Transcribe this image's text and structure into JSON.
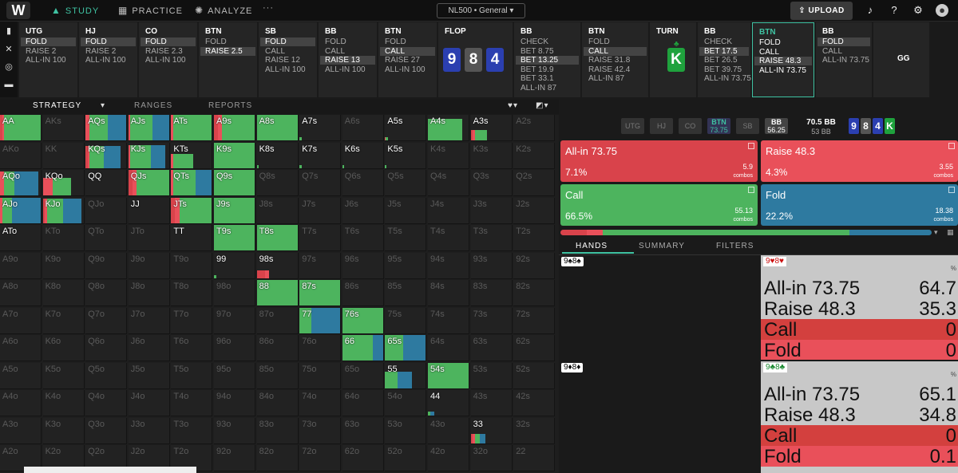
{
  "topbar": {
    "logo": "W",
    "nav": [
      {
        "label": "STUDY",
        "icon": "graduation-cap-icon"
      },
      {
        "label": "PRACTICE",
        "icon": "gamepad-icon"
      },
      {
        "label": "ANALYZE",
        "icon": "lightbulb-icon"
      }
    ],
    "more": "···",
    "game_select": "NL500 • General",
    "upload_label": "UPLOAD"
  },
  "action_columns": [
    {
      "title": "UTG",
      "options": [
        {
          "t": "FOLD",
          "sel": true
        },
        {
          "t": "RAISE 2"
        },
        {
          "t": "ALL-IN 100"
        }
      ]
    },
    {
      "title": "HJ",
      "options": [
        {
          "t": "FOLD",
          "sel": true
        },
        {
          "t": "RAISE 2"
        },
        {
          "t": "ALL-IN 100"
        }
      ]
    },
    {
      "title": "CO",
      "options": [
        {
          "t": "FOLD",
          "sel": true
        },
        {
          "t": "RAISE 2.3"
        },
        {
          "t": "ALL-IN 100"
        }
      ]
    },
    {
      "title": "BTN",
      "options": [
        {
          "t": "FOLD"
        },
        {
          "t": "RAISE 2.5",
          "sel": true
        }
      ]
    },
    {
      "title": "SB",
      "options": [
        {
          "t": "FOLD",
          "sel": true
        },
        {
          "t": "CALL"
        },
        {
          "t": "RAISE 12"
        },
        {
          "t": "ALL-IN 100"
        }
      ]
    },
    {
      "title": "BB",
      "options": [
        {
          "t": "FOLD"
        },
        {
          "t": "CALL"
        },
        {
          "t": "RAISE 13",
          "sel": true
        },
        {
          "t": "ALL-IN 100"
        }
      ]
    },
    {
      "title": "BTN",
      "options": [
        {
          "t": "FOLD"
        },
        {
          "t": "CALL",
          "sel": true
        },
        {
          "t": "RAISE 27"
        },
        {
          "t": "ALL-IN 100"
        }
      ]
    },
    {
      "title": "FLOP",
      "cards": [
        "9",
        "8",
        "4"
      ]
    },
    {
      "title": "BB",
      "options": [
        {
          "t": "CHECK"
        },
        {
          "t": "BET 8.75"
        },
        {
          "t": "BET 13.25",
          "sel": true
        },
        {
          "t": "BET 19.9"
        },
        {
          "t": "BET 33.1"
        },
        {
          "t": "ALL-IN 87"
        }
      ]
    },
    {
      "title": "BTN",
      "options": [
        {
          "t": "FOLD"
        },
        {
          "t": "CALL",
          "sel": true
        },
        {
          "t": "RAISE 31.8"
        },
        {
          "t": "RAISE 42.4"
        },
        {
          "t": "ALL-IN 87"
        }
      ]
    },
    {
      "title": "TURN",
      "cards": [
        "K"
      ]
    },
    {
      "title": "BB",
      "options": [
        {
          "t": "CHECK"
        },
        {
          "t": "BET 17.5",
          "sel": true
        },
        {
          "t": "BET 26.5"
        },
        {
          "t": "BET 39.75"
        },
        {
          "t": "ALL-IN 73.75"
        }
      ]
    },
    {
      "title": "BTN",
      "active": true,
      "options": [
        {
          "t": "FOLD"
        },
        {
          "t": "CALL"
        },
        {
          "t": "RAISE 48.3",
          "sel": true
        },
        {
          "t": "ALL-IN 73.75"
        }
      ]
    },
    {
      "title": "BB",
      "options": [
        {
          "t": "FOLD",
          "sel": true
        },
        {
          "t": "CALL"
        },
        {
          "t": "ALL-IN 73.75"
        }
      ]
    },
    {
      "title": "GG"
    }
  ],
  "main_tabs": [
    "STRATEGY",
    "RANGES",
    "REPORTS"
  ],
  "grid": {
    "ranks": [
      "A",
      "K",
      "Q",
      "J",
      "T",
      "9",
      "8",
      "7",
      "6",
      "5",
      "4",
      "3",
      "2"
    ],
    "hands": {
      "AA": [
        0.05,
        0.05,
        0.9,
        0
      ],
      "AQs": [
        0,
        0.1,
        0.45,
        0.45
      ],
      "AJs": [
        0,
        0.05,
        0.55,
        0.4
      ],
      "ATs": [
        0,
        0.05,
        0.95,
        0
      ],
      "A9s": [
        0.1,
        0.1,
        0.8,
        0
      ],
      "A8s": [
        0,
        0,
        1,
        0
      ],
      "A7s": [
        0,
        0,
        0.05,
        0
      ],
      "A5s": [
        0,
        0.02,
        0.05,
        0
      ],
      "A4s": [
        0,
        0,
        0.85,
        0
      ],
      "A3s": [
        0.05,
        0.05,
        0.3,
        0
      ],
      "KQs": [
        0.05,
        0.05,
        0.35,
        0.4
      ],
      "KJs": [
        0,
        0.05,
        0.5,
        0.35
      ],
      "KTs": [
        0,
        0.05,
        0.5,
        0
      ],
      "K9s": [
        0,
        0,
        1,
        0
      ],
      "K8s": [
        0,
        0,
        0.05,
        0
      ],
      "K7s": [
        0,
        0,
        0.05,
        0
      ],
      "K6s": [
        0,
        0,
        0.05,
        0
      ],
      "K5s": [
        0,
        0,
        0.04,
        0
      ],
      "AQo": [
        0,
        0.1,
        0.25,
        0.6
      ],
      "KQo": [
        0,
        0.25,
        0.45,
        0
      ],
      "QJs": [
        0.1,
        0.1,
        0.8,
        0
      ],
      "QTs": [
        0,
        0.05,
        0.55,
        0.4
      ],
      "Q9s": [
        0,
        0,
        1,
        0
      ],
      "AJo": [
        0,
        0.05,
        0.25,
        0.7
      ],
      "KJo": [
        0.05,
        0.05,
        0.4,
        0.45
      ],
      "JTs": [
        0.1,
        0.1,
        0.8,
        0
      ],
      "J9s": [
        0,
        0,
        1,
        0
      ],
      "T9s": [
        0,
        0,
        1,
        0
      ],
      "T8s": [
        0,
        0,
        1,
        0
      ],
      "99": [
        0,
        0,
        0.05,
        0
      ],
      "98s": [
        0.2,
        0.1,
        0,
        0
      ],
      "88": [
        0,
        0,
        1,
        0
      ],
      "87s": [
        0,
        0,
        1,
        0
      ],
      "77": [
        0,
        0,
        0.3,
        0.7
      ],
      "76s": [
        0,
        0,
        1,
        0
      ],
      "66": [
        0,
        0,
        0.75,
        0.25
      ],
      "65s": [
        0,
        0,
        0.45,
        0.55
      ],
      "55": [
        0,
        0,
        0.3,
        0.35
      ],
      "54s": [
        0,
        0,
        1,
        0
      ],
      "44": [
        0,
        0,
        0.05,
        0.1
      ],
      "33": [
        0.05,
        0.05,
        0.12,
        0.15
      ],
      "AK": [
        0,
        0,
        0,
        0
      ],
      "ATo": [
        0,
        0,
        0,
        0
      ],
      "KK": [
        0,
        0,
        0,
        0
      ],
      "QQ": [
        0,
        0,
        0,
        0
      ],
      "JJ": [
        0,
        0,
        0,
        0
      ],
      "TT": [
        0,
        0,
        0,
        0
      ]
    }
  },
  "right": {
    "positions": [
      "UTG",
      "HJ",
      "CO",
      "BTN",
      "SB",
      "BB"
    ],
    "position_stacks": {
      "BTN": "73.75",
      "BB": "56.25"
    },
    "pot": "70.5 BB",
    "stack": "53 BB",
    "board": [
      "9",
      "8",
      "4",
      "K"
    ],
    "actions": [
      {
        "name": "All-in 73.75",
        "pct": "7.1%",
        "combos": "5.9",
        "color": "#d9434b"
      },
      {
        "name": "Raise 48.3",
        "pct": "4.3%",
        "combos": "3.55",
        "color": "#e9505a"
      },
      {
        "name": "Call",
        "pct": "66.5%",
        "combos": "55.13",
        "color": "#4db45e"
      },
      {
        "name": "Fold",
        "pct": "22.2%",
        "combos": "18.38",
        "color": "#2e7aa0"
      }
    ],
    "combos_label": "combos",
    "freq": {
      "allin": 0.071,
      "raise": 0.043,
      "call": 0.665,
      "fold": 0.222
    },
    "tabs": [
      "HANDS",
      "SUMMARY",
      "FILTERS"
    ],
    "combo1": "9♠8♠",
    "combo2": "9♦8♦",
    "card1": {
      "hand": "9♥8♥",
      "rows": [
        {
          "n": "All-in 73.75",
          "v": "64.7"
        },
        {
          "n": "Raise 48.3",
          "v": "35.3"
        },
        {
          "n": "Call",
          "v": "0"
        },
        {
          "n": "Fold",
          "v": "0"
        }
      ]
    },
    "card2": {
      "hand": "9♣8♣",
      "rows": [
        {
          "n": "All-in 73.75",
          "v": "65.1"
        },
        {
          "n": "Raise 48.3",
          "v": "34.8"
        },
        {
          "n": "Call",
          "v": "0"
        },
        {
          "n": "Fold",
          "v": "0.1"
        }
      ]
    },
    "pct_label": "%"
  },
  "colors": {
    "allin": "#d9434b",
    "raise": "#e9505a",
    "call": "#4db45e",
    "fold": "#2e7aa0",
    "accent": "#3fc2a2"
  }
}
